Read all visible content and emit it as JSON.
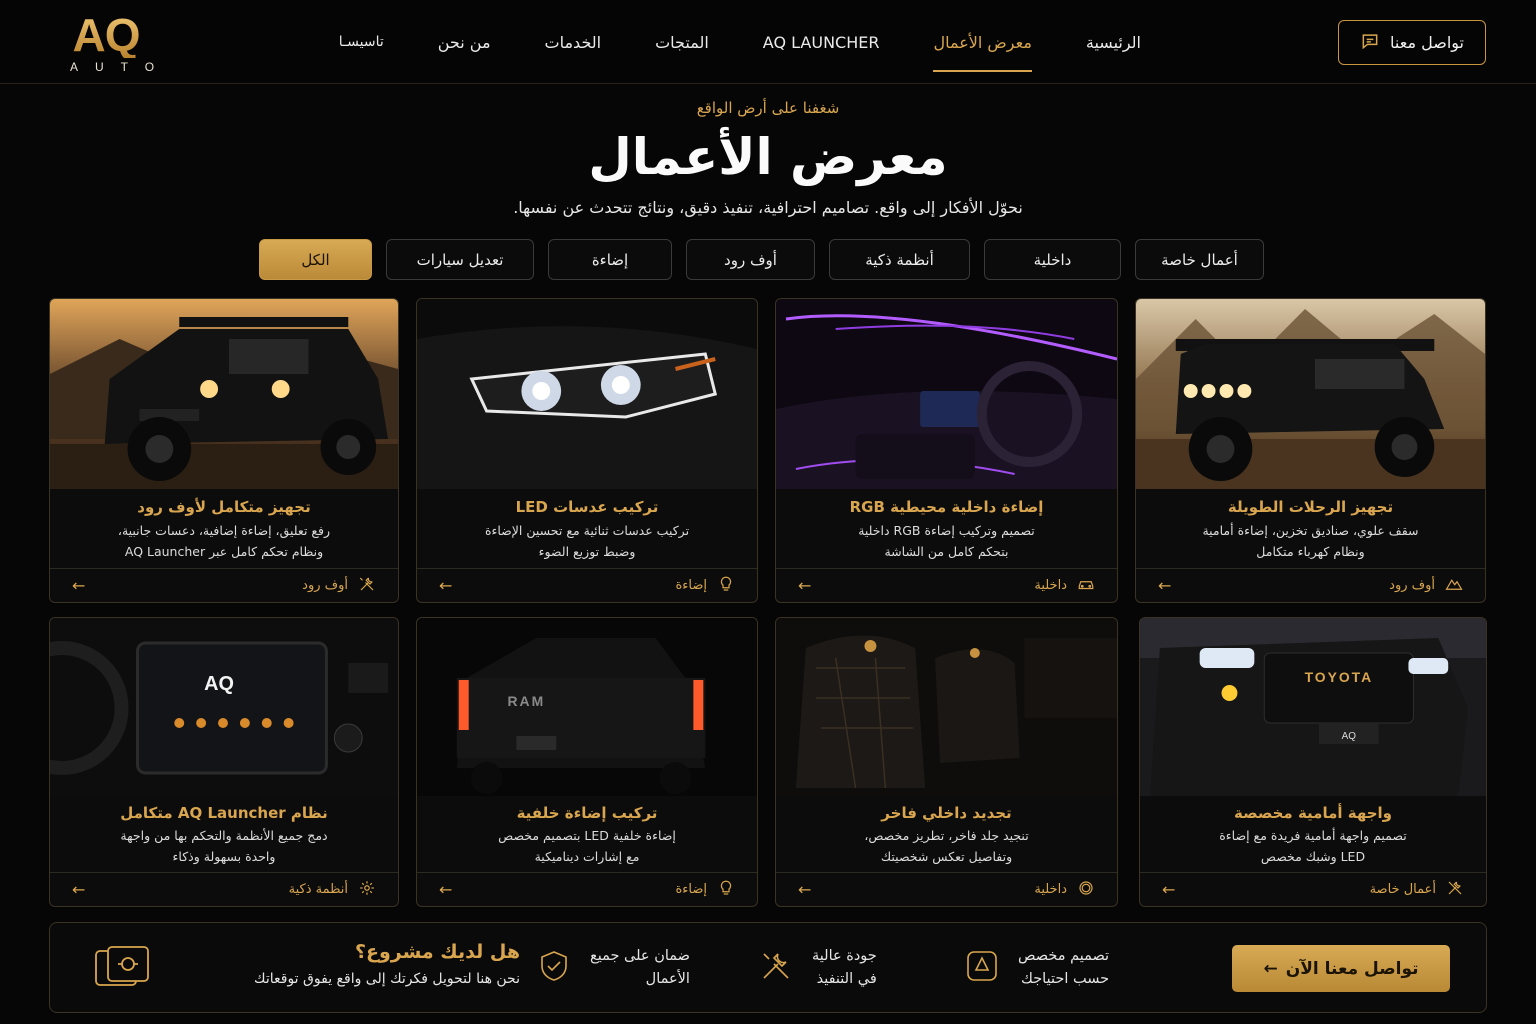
{
  "brand": {
    "logo_main": "AQ",
    "logo_sub": "AUTO",
    "accent": "#d9a64f"
  },
  "nav": {
    "items": [
      {
        "label": "الرئيسية",
        "active": false
      },
      {
        "label": "معرض الأعمال",
        "active": true
      },
      {
        "label": "AQ LAUNCHER",
        "active": false
      },
      {
        "label": "المتجات",
        "active": false
      },
      {
        "label": "الخدمات",
        "active": false
      },
      {
        "label": "من نحن",
        "active": false
      },
      {
        "label": "تاسيسـا",
        "active": false
      }
    ],
    "contact_label": "تواصل معنا",
    "contact_icon": "chat-icon"
  },
  "hero": {
    "eyebrow": "شغفنا على أرض الواقع",
    "title": "معرض الأعمال",
    "subtitle": "نحوّل الأفكار إلى واقع. تصاميم احترافية، تنفيذ دقيق، ونتائج تتحدث عن نفسها."
  },
  "filters": [
    {
      "label": "أعمال خاصة",
      "active": false
    },
    {
      "label": "داخلية",
      "active": false
    },
    {
      "label": "أنظمة ذكية",
      "active": false
    },
    {
      "label": "أوف رود",
      "active": false
    },
    {
      "label": "إضاءة",
      "active": false
    },
    {
      "label": "تعديل سيارات",
      "active": false
    },
    {
      "label": "الكل",
      "active": true
    }
  ],
  "cards": [
    {
      "title": "تجهيز الرحلات الطويلة",
      "desc1": "سقف علوي، صناديق تخزين، إضاءة أمامية",
      "desc2": "ونظام كهرباء متكامل",
      "tag": "أوف رود",
      "tag_icon": "mountain-icon",
      "image": "offroad-suv-desert"
    },
    {
      "title": "إضاءة داخلية محيطية RGB",
      "desc1": "تصميم وتركيب إضاءة RGB داخلية",
      "desc2": "بتحكم كامل من الشاشة",
      "tag": "داخلية",
      "tag_icon": "car-icon",
      "image": "purple-ambient-interior"
    },
    {
      "title": "تركيب عدسات LED",
      "desc1": "تركيب عدسات ثنائية مع تحسين الإضاءة",
      "desc2": "وضبط توزيع الضوء",
      "tag": "إضاءة",
      "tag_icon": "bulb-icon",
      "image": "led-headlight"
    },
    {
      "title": "تجهيز متكامل لأوف رود",
      "desc1": "رفع تعليق، إضاءة إضافية، دعسات جانبية،",
      "desc2": "ونظام تحكم كامل عبر AQ Launcher",
      "tag": "أوف رود",
      "tag_icon": "tools-icon",
      "image": "offroad-suv-sunset"
    },
    {
      "title": "واجهة أمامية مخصصة",
      "desc1": "تصميم واجهة أمامية فريدة مع إضاءة",
      "desc2": "LED وشبك مخصص",
      "tag": "أعمال خاصة",
      "tag_icon": "wrench-icon",
      "image": "toyota-front-grille"
    },
    {
      "title": "تجديد داخلي فاخر",
      "desc1": "تنجيد جلد فاخر، تطريز مخصص،",
      "desc2": "وتفاصيل تعكس شخصيتك",
      "tag": "داخلية",
      "tag_icon": "circle-icon",
      "image": "leather-seats"
    },
    {
      "title": "تركيب إضاءة خلفية",
      "desc1": "إضاءة خلفية LED بتصميم مخصص",
      "desc2": "مع إشارات ديناميكية",
      "tag": "إضاءة",
      "tag_icon": "bulb-icon",
      "image": "ram-truck-rear"
    },
    {
      "title": "نظام AQ Launcher متكامل",
      "desc1": "دمج جميع الأنظمة والتحكم بها من واجهة",
      "desc2": "واحدة بسهولة وذكاء",
      "tag": "أنظمة ذكية",
      "tag_icon": "gear-icon",
      "image": "dashboard-screen"
    }
  ],
  "image_text": {
    "screen_logo": "AQ",
    "grille_text": "TOYOTA",
    "tailgate_text": "RAM",
    "plate_text": "AQ"
  },
  "cta": {
    "button": "تواصل معنا الآن",
    "features": [
      {
        "line1": "تصميم مخصص",
        "line2": "حسب احتياجك",
        "icon": "design-icon"
      },
      {
        "line1": "جودة عالية",
        "line2": "في التنفيذ",
        "icon": "tools-icon"
      },
      {
        "line1": "ضمان على جميع",
        "line2": "الأعمال",
        "icon": "shield-icon"
      }
    ],
    "question": "هل لديك مشروع؟",
    "question_sub": "نحن هنا لتحويل فكرتك إلى واقع يفوق توقعاتك",
    "icon": "project-icon"
  }
}
